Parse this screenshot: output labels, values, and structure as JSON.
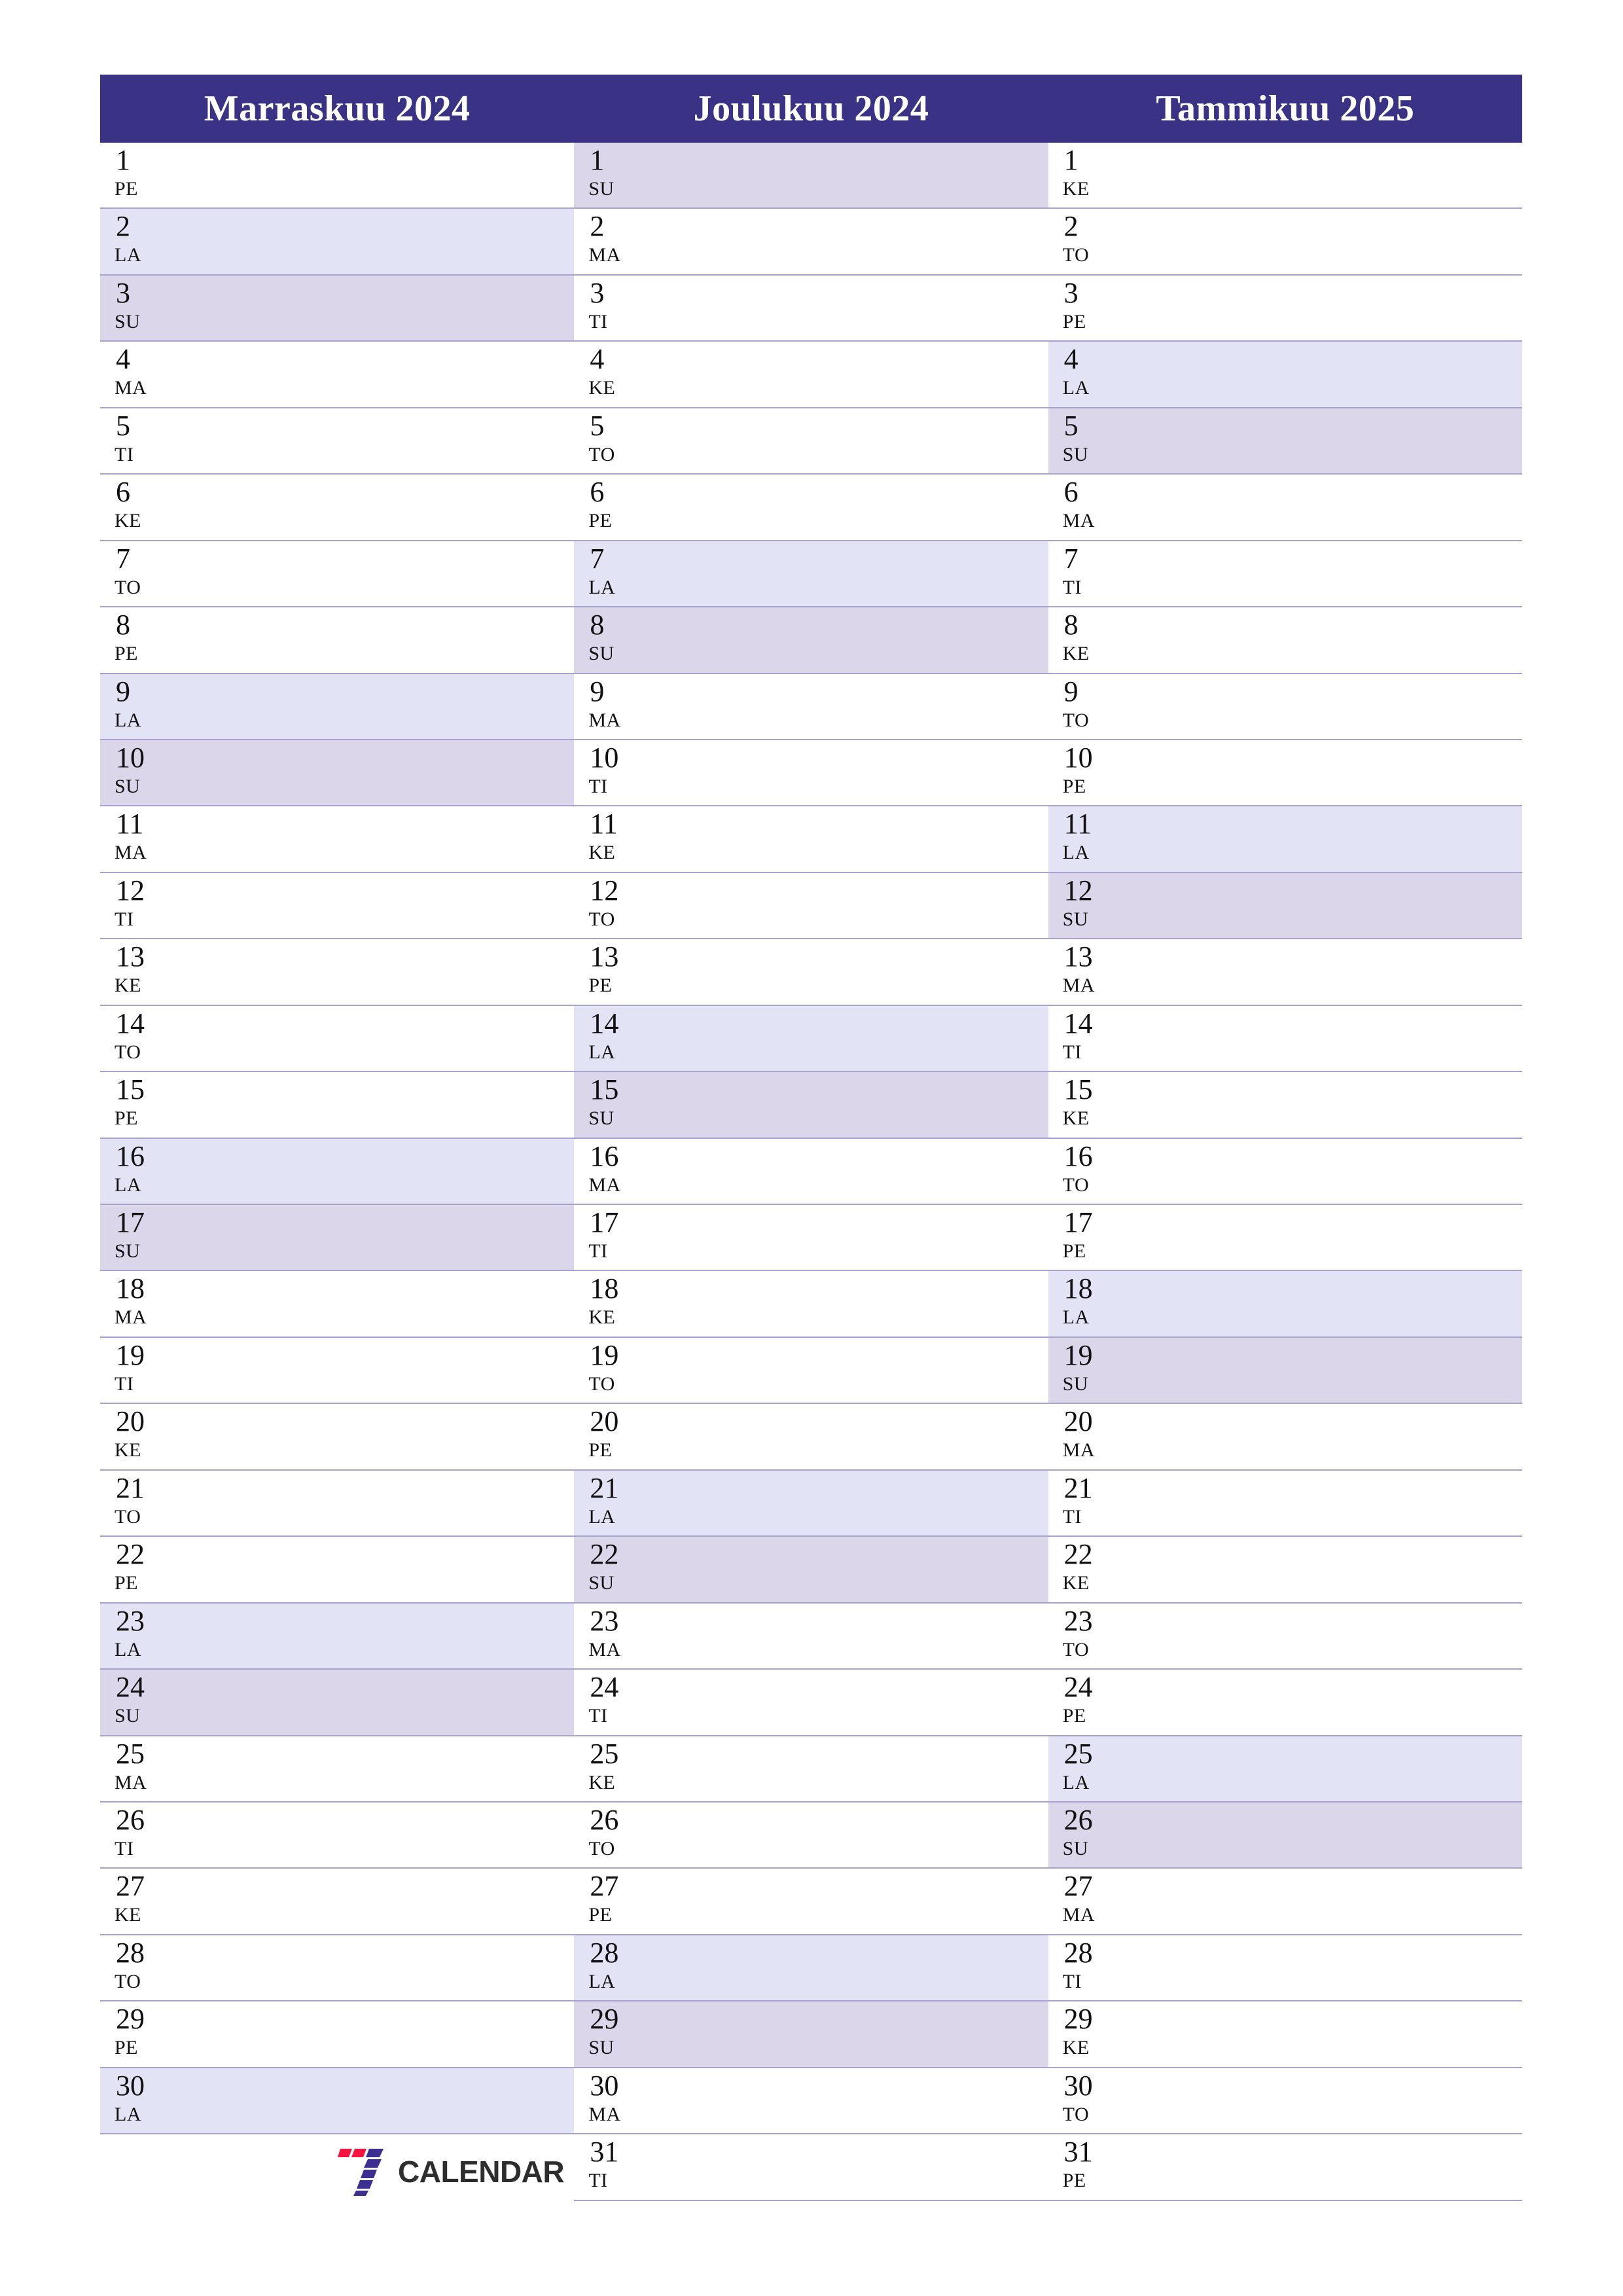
{
  "document": {
    "type": "printable-monthly-planner",
    "locale": "fi",
    "orientation": "portrait",
    "paper": "A4"
  },
  "theme": {
    "header_bg": "#393285",
    "header_text": "#ffffff",
    "saturday_bg": "#e3e3f6",
    "sunday_bg": "#dbd6ea",
    "weekday_bg": "#ffffff",
    "row_border": "#a8a3cc",
    "text": "#111111",
    "logo_red": "#f4143f",
    "logo_blue": "#3b2f92",
    "logo_text": "#2e2e2e"
  },
  "brand": {
    "name": "CALENDAR",
    "mark": "seven-logo"
  },
  "months": [
    {
      "title": "Marraskuu 2024",
      "days": [
        {
          "num": "1",
          "abbr": "PE",
          "kind": "weekday"
        },
        {
          "num": "2",
          "abbr": "LA",
          "kind": "sat"
        },
        {
          "num": "3",
          "abbr": "SU",
          "kind": "sun"
        },
        {
          "num": "4",
          "abbr": "MA",
          "kind": "weekday"
        },
        {
          "num": "5",
          "abbr": "TI",
          "kind": "weekday"
        },
        {
          "num": "6",
          "abbr": "KE",
          "kind": "weekday"
        },
        {
          "num": "7",
          "abbr": "TO",
          "kind": "weekday"
        },
        {
          "num": "8",
          "abbr": "PE",
          "kind": "weekday"
        },
        {
          "num": "9",
          "abbr": "LA",
          "kind": "sat"
        },
        {
          "num": "10",
          "abbr": "SU",
          "kind": "sun"
        },
        {
          "num": "11",
          "abbr": "MA",
          "kind": "weekday"
        },
        {
          "num": "12",
          "abbr": "TI",
          "kind": "weekday"
        },
        {
          "num": "13",
          "abbr": "KE",
          "kind": "weekday"
        },
        {
          "num": "14",
          "abbr": "TO",
          "kind": "weekday"
        },
        {
          "num": "15",
          "abbr": "PE",
          "kind": "weekday"
        },
        {
          "num": "16",
          "abbr": "LA",
          "kind": "sat"
        },
        {
          "num": "17",
          "abbr": "SU",
          "kind": "sun"
        },
        {
          "num": "18",
          "abbr": "MA",
          "kind": "weekday"
        },
        {
          "num": "19",
          "abbr": "TI",
          "kind": "weekday"
        },
        {
          "num": "20",
          "abbr": "KE",
          "kind": "weekday"
        },
        {
          "num": "21",
          "abbr": "TO",
          "kind": "weekday"
        },
        {
          "num": "22",
          "abbr": "PE",
          "kind": "weekday"
        },
        {
          "num": "23",
          "abbr": "LA",
          "kind": "sat"
        },
        {
          "num": "24",
          "abbr": "SU",
          "kind": "sun"
        },
        {
          "num": "25",
          "abbr": "MA",
          "kind": "weekday"
        },
        {
          "num": "26",
          "abbr": "TI",
          "kind": "weekday"
        },
        {
          "num": "27",
          "abbr": "KE",
          "kind": "weekday"
        },
        {
          "num": "28",
          "abbr": "TO",
          "kind": "weekday"
        },
        {
          "num": "29",
          "abbr": "PE",
          "kind": "weekday"
        },
        {
          "num": "30",
          "abbr": "LA",
          "kind": "sat"
        }
      ]
    },
    {
      "title": "Joulukuu 2024",
      "days": [
        {
          "num": "1",
          "abbr": "SU",
          "kind": "sun"
        },
        {
          "num": "2",
          "abbr": "MA",
          "kind": "weekday"
        },
        {
          "num": "3",
          "abbr": "TI",
          "kind": "weekday"
        },
        {
          "num": "4",
          "abbr": "KE",
          "kind": "weekday"
        },
        {
          "num": "5",
          "abbr": "TO",
          "kind": "weekday"
        },
        {
          "num": "6",
          "abbr": "PE",
          "kind": "weekday"
        },
        {
          "num": "7",
          "abbr": "LA",
          "kind": "sat"
        },
        {
          "num": "8",
          "abbr": "SU",
          "kind": "sun"
        },
        {
          "num": "9",
          "abbr": "MA",
          "kind": "weekday"
        },
        {
          "num": "10",
          "abbr": "TI",
          "kind": "weekday"
        },
        {
          "num": "11",
          "abbr": "KE",
          "kind": "weekday"
        },
        {
          "num": "12",
          "abbr": "TO",
          "kind": "weekday"
        },
        {
          "num": "13",
          "abbr": "PE",
          "kind": "weekday"
        },
        {
          "num": "14",
          "abbr": "LA",
          "kind": "sat"
        },
        {
          "num": "15",
          "abbr": "SU",
          "kind": "sun"
        },
        {
          "num": "16",
          "abbr": "MA",
          "kind": "weekday"
        },
        {
          "num": "17",
          "abbr": "TI",
          "kind": "weekday"
        },
        {
          "num": "18",
          "abbr": "KE",
          "kind": "weekday"
        },
        {
          "num": "19",
          "abbr": "TO",
          "kind": "weekday"
        },
        {
          "num": "20",
          "abbr": "PE",
          "kind": "weekday"
        },
        {
          "num": "21",
          "abbr": "LA",
          "kind": "sat"
        },
        {
          "num": "22",
          "abbr": "SU",
          "kind": "sun"
        },
        {
          "num": "23",
          "abbr": "MA",
          "kind": "weekday"
        },
        {
          "num": "24",
          "abbr": "TI",
          "kind": "weekday"
        },
        {
          "num": "25",
          "abbr": "KE",
          "kind": "weekday"
        },
        {
          "num": "26",
          "abbr": "TO",
          "kind": "weekday"
        },
        {
          "num": "27",
          "abbr": "PE",
          "kind": "weekday"
        },
        {
          "num": "28",
          "abbr": "LA",
          "kind": "sat"
        },
        {
          "num": "29",
          "abbr": "SU",
          "kind": "sun"
        },
        {
          "num": "30",
          "abbr": "MA",
          "kind": "weekday"
        },
        {
          "num": "31",
          "abbr": "TI",
          "kind": "weekday"
        }
      ]
    },
    {
      "title": "Tammikuu 2025",
      "days": [
        {
          "num": "1",
          "abbr": "KE",
          "kind": "weekday"
        },
        {
          "num": "2",
          "abbr": "TO",
          "kind": "weekday"
        },
        {
          "num": "3",
          "abbr": "PE",
          "kind": "weekday"
        },
        {
          "num": "4",
          "abbr": "LA",
          "kind": "sat"
        },
        {
          "num": "5",
          "abbr": "SU",
          "kind": "sun"
        },
        {
          "num": "6",
          "abbr": "MA",
          "kind": "weekday"
        },
        {
          "num": "7",
          "abbr": "TI",
          "kind": "weekday"
        },
        {
          "num": "8",
          "abbr": "KE",
          "kind": "weekday"
        },
        {
          "num": "9",
          "abbr": "TO",
          "kind": "weekday"
        },
        {
          "num": "10",
          "abbr": "PE",
          "kind": "weekday"
        },
        {
          "num": "11",
          "abbr": "LA",
          "kind": "sat"
        },
        {
          "num": "12",
          "abbr": "SU",
          "kind": "sun"
        },
        {
          "num": "13",
          "abbr": "MA",
          "kind": "weekday"
        },
        {
          "num": "14",
          "abbr": "TI",
          "kind": "weekday"
        },
        {
          "num": "15",
          "abbr": "KE",
          "kind": "weekday"
        },
        {
          "num": "16",
          "abbr": "TO",
          "kind": "weekday"
        },
        {
          "num": "17",
          "abbr": "PE",
          "kind": "weekday"
        },
        {
          "num": "18",
          "abbr": "LA",
          "kind": "sat"
        },
        {
          "num": "19",
          "abbr": "SU",
          "kind": "sun"
        },
        {
          "num": "20",
          "abbr": "MA",
          "kind": "weekday"
        },
        {
          "num": "21",
          "abbr": "TI",
          "kind": "weekday"
        },
        {
          "num": "22",
          "abbr": "KE",
          "kind": "weekday"
        },
        {
          "num": "23",
          "abbr": "TO",
          "kind": "weekday"
        },
        {
          "num": "24",
          "abbr": "PE",
          "kind": "weekday"
        },
        {
          "num": "25",
          "abbr": "LA",
          "kind": "sat"
        },
        {
          "num": "26",
          "abbr": "SU",
          "kind": "sun"
        },
        {
          "num": "27",
          "abbr": "MA",
          "kind": "weekday"
        },
        {
          "num": "28",
          "abbr": "TI",
          "kind": "weekday"
        },
        {
          "num": "29",
          "abbr": "KE",
          "kind": "weekday"
        },
        {
          "num": "30",
          "abbr": "TO",
          "kind": "weekday"
        },
        {
          "num": "31",
          "abbr": "PE",
          "kind": "weekday"
        }
      ]
    }
  ]
}
